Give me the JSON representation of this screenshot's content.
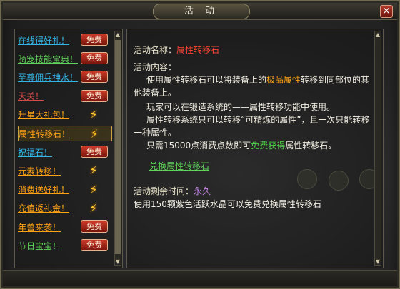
{
  "window": {
    "title": "活 动",
    "close_glyph": "×"
  },
  "list": {
    "items": [
      {
        "label": "在线得好礼！",
        "color": "#35b5e5",
        "action": "free"
      },
      {
        "label": "骑宠技能宝典！",
        "color": "#5fd35a",
        "action": "free"
      },
      {
        "label": "至尊佣兵神水！",
        "color": "#35b5e5",
        "action": "free"
      },
      {
        "label": "天关！",
        "color": "#d74a4a",
        "action": "free"
      },
      {
        "label": "升星大礼包！",
        "color": "#ffa216",
        "action": "bolt"
      },
      {
        "label": "属性转移石！",
        "color": "#ffa216",
        "action": "bolt",
        "selected": true
      },
      {
        "label": "祝福石！",
        "color": "#35b5e5",
        "action": "free"
      },
      {
        "label": "元素转移！",
        "color": "#ffa216",
        "action": "bolt"
      },
      {
        "label": "消费送好礼！",
        "color": "#ffa216",
        "action": "bolt"
      },
      {
        "label": "充值返礼金！",
        "color": "#ffa216",
        "action": "bolt"
      },
      {
        "label": "年兽来袭！",
        "color": "#ffa216",
        "action": "free"
      },
      {
        "label": "节日宝宝！",
        "color": "#5fd35a",
        "action": "free"
      }
    ],
    "free_label": "免费",
    "bolt_glyph": "⚡"
  },
  "detail": {
    "name_label": "活动名称：",
    "name_value": "属性转移石",
    "content_label": "活动内容：",
    "para1_a": "使用属性转移石可以将装备上的",
    "para1_highlight": "极品属性",
    "para1_b": "转移到同部位的其他装备上。",
    "para2": "玩家可以在锻造系统的——属性转移功能中使用。",
    "para3": "属性转移系统只可以转移“可精炼的属性”，且一次只能转移一种属性。",
    "para4_a": "只需15000点消费点数即可",
    "para4_highlight": "免费获得",
    "para4_b": "属性转移石。",
    "exchange_link": "兑换属性转移石",
    "time_label": "活动剩余时间：",
    "time_value": "永久",
    "note": "使用150颗紫色活跃水晶可以免费兑换属性转移石"
  },
  "scrollbar": {
    "up_glyph": "▲",
    "down_glyph": "▼"
  }
}
